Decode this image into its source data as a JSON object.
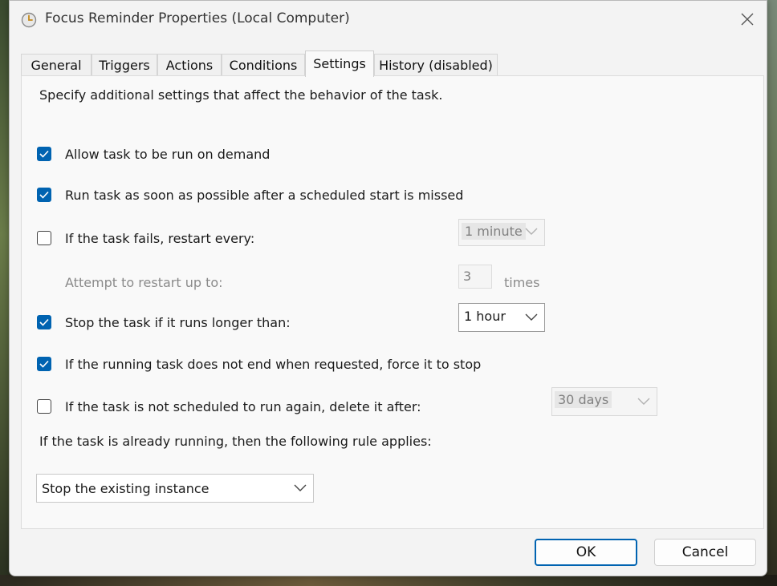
{
  "window": {
    "title": "Focus Reminder Properties (Local Computer)"
  },
  "tabs": [
    {
      "label": "General"
    },
    {
      "label": "Triggers"
    },
    {
      "label": "Actions"
    },
    {
      "label": "Conditions"
    },
    {
      "label": "Settings",
      "active": true
    },
    {
      "label": "History (disabled)"
    }
  ],
  "settings": {
    "intro": "Specify additional settings that affect the behavior of the task.",
    "allow_demand": {
      "label": "Allow task to be run on demand",
      "checked": true
    },
    "run_missed": {
      "label": "Run task as soon as possible after a scheduled start is missed",
      "checked": true
    },
    "restart": {
      "label": "If the task fails, restart every:",
      "checked": false,
      "interval": "1 minute"
    },
    "attempts": {
      "label": "Attempt to restart up to:",
      "value": "3",
      "unit": "times"
    },
    "stop_long": {
      "label": "Stop the task if it runs longer than:",
      "checked": true,
      "duration": "1 hour"
    },
    "force_stop": {
      "label": "If the running task does not end when requested, force it to stop",
      "checked": true
    },
    "delete_after": {
      "label": "If the task is not scheduled to run again, delete it after:",
      "checked": false,
      "duration": "30 days"
    },
    "rule_label": "If the task is already running, then the following rule applies:",
    "rule_value": "Stop the existing instance"
  },
  "footer": {
    "ok_label": "OK",
    "cancel_label": "Cancel"
  },
  "colors": {
    "accent": "#0063b1"
  }
}
